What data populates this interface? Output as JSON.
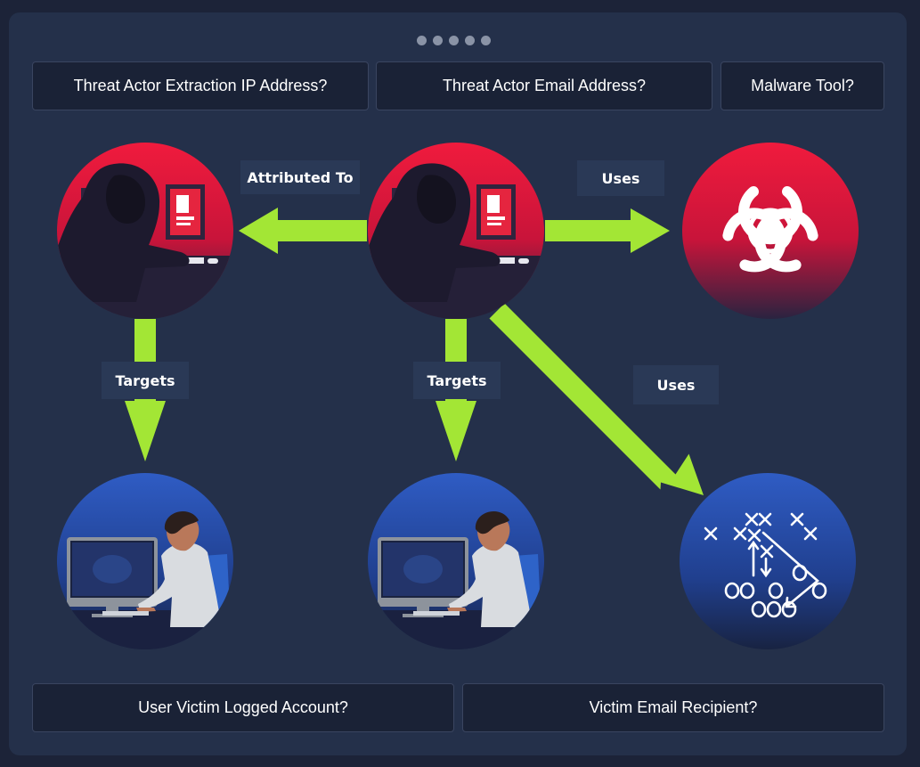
{
  "questions": {
    "extraction_ip": "Threat Actor Extraction IP Address?",
    "email_address": "Threat Actor Email Address?",
    "malware_tool": "Malware Tool?",
    "victim_logged_account": "User Victim Logged Account?",
    "victim_email_recipient": "Victim Email Recipient?"
  },
  "relations": {
    "attributed_to": "Attributed To",
    "uses_malware": "Uses",
    "uses_tactic": "Uses",
    "targets_left": "Targets",
    "targets_center": "Targets"
  },
  "pagination": {
    "dot_count": 5
  },
  "colors": {
    "arrow": "#a3e635",
    "threat": "#e8193c",
    "victim": "#2b55b8",
    "panel": "#24304a"
  },
  "icons": {
    "threat_actor": "hooded-hacker-icon",
    "malware": "biohazard-icon",
    "victim": "user-at-computer-icon",
    "tactics": "playbook-icon"
  }
}
